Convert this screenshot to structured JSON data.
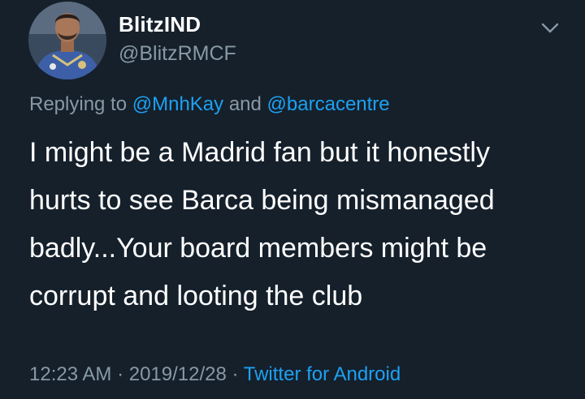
{
  "author": {
    "display_name": "BlitzIND",
    "handle": "@BlitzRMCF",
    "avatar_icon": "profile-photo"
  },
  "reply": {
    "prefix": "Replying to ",
    "mention_1": "@MnhKay",
    "connector": " and ",
    "mention_2": "@barcacentre"
  },
  "tweet": {
    "lines": [
      "I might be a Madrid fan but it honestly",
      "hurts to see Barca being mismanaged",
      "badly...Your board members might be",
      "corrupt and looting the club"
    ]
  },
  "meta": {
    "time": "12:23 AM",
    "separator": " · ",
    "date": "2019/12/28",
    "source": "Twitter for Android"
  },
  "colors": {
    "background": "#15202b",
    "accent": "#1da1f2",
    "secondary_text": "#8899a6"
  },
  "icons": {
    "menu": "chevron-down-icon"
  }
}
